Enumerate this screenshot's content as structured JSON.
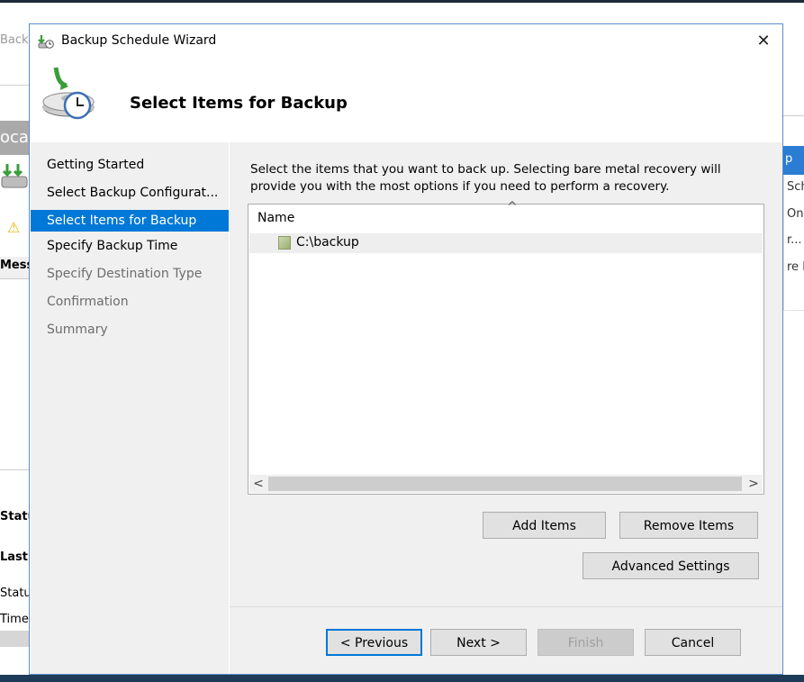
{
  "background_app": {
    "title_fragment": "Backu",
    "header_fragment": "oca",
    "message_header": "Messa",
    "lower_labels": [
      "Status",
      "Last B",
      "Status",
      "Time"
    ],
    "right_panel": {
      "selected": "p",
      "items": [
        "Sch",
        "On",
        "r...",
        "re l"
      ]
    }
  },
  "dialog": {
    "title": "Backup Schedule Wizard",
    "close_label": "✕",
    "header_title": "Select Items for Backup",
    "nav": [
      {
        "label": "Getting Started",
        "state": "normal"
      },
      {
        "label": "Select Backup Configurat...",
        "state": "normal"
      },
      {
        "label": "Select Items for Backup",
        "state": "selected"
      },
      {
        "label": "Specify Backup Time",
        "state": "normal"
      },
      {
        "label": "Specify Destination Type",
        "state": "disabled"
      },
      {
        "label": "Confirmation",
        "state": "disabled"
      },
      {
        "label": "Summary",
        "state": "disabled"
      }
    ],
    "description": "Select the items that you want to back up. Selecting bare metal recovery will provide you with the most options if you need to perform a recovery.",
    "list": {
      "column_header": "Name",
      "sort_glyph": "^",
      "items": [
        {
          "label": "C:\\backup",
          "icon": "folder-icon"
        }
      ],
      "scroll_left": "<",
      "scroll_right": ">"
    },
    "buttons": {
      "add_items": "Add Items",
      "remove_items": "Remove Items",
      "advanced_settings": "Advanced Settings",
      "previous": "< Previous",
      "next": "Next >",
      "finish": "Finish",
      "cancel": "Cancel"
    }
  },
  "colors": {
    "selection": "#0078d7",
    "dialog_border": "#5b8cc8",
    "panel": "#f0f0f0",
    "button": "#e1e1e1"
  }
}
